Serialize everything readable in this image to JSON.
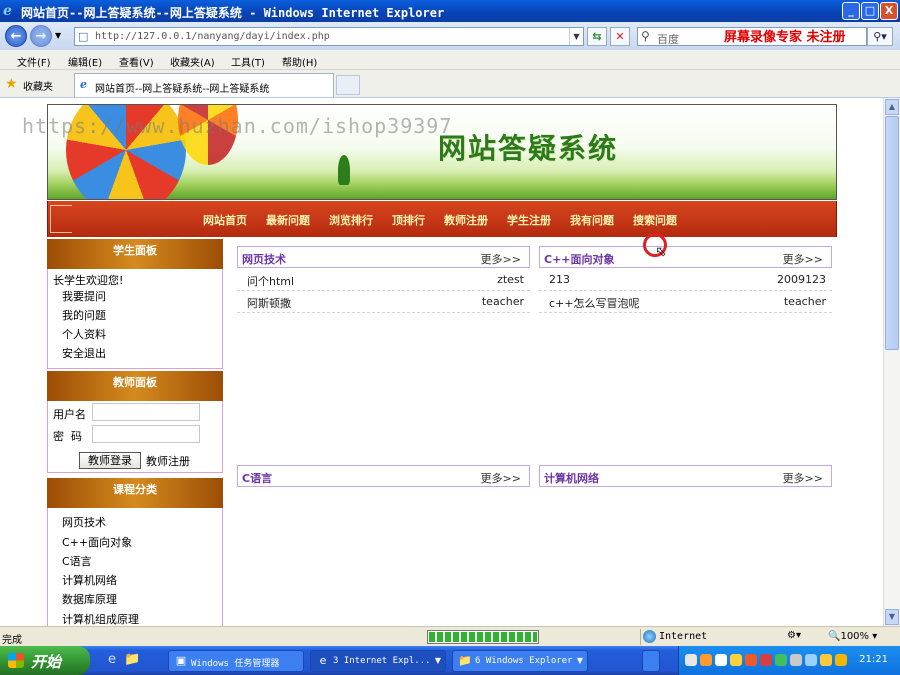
{
  "window": {
    "title": "网站首页--网上答疑系统--网上答疑系统 - Windows Internet Explorer",
    "buttons": {
      "minimize": "_",
      "maximize": "□",
      "close": "X"
    }
  },
  "addressbar": {
    "url": "http://127.0.0.1/nanyang/dayi/index.php",
    "search_placeholder": "百度",
    "watermark": "屏幕录像专家  未注册"
  },
  "menu": [
    "文件(F)",
    "编辑(E)",
    "查看(V)",
    "收藏夹(A)",
    "工具(T)",
    "帮助(H)"
  ],
  "favorites_label": "收藏夹",
  "tab": {
    "label": "网站首页--网上答疑系统--网上答疑系统"
  },
  "overlay_watermark": "https://www.huzhan.com/ishop39397",
  "site": {
    "banner_title": "网站答疑系统",
    "nav": [
      "网站首页",
      "最新问题",
      "浏览排行",
      "顶排行",
      "教师注册",
      "学生注册",
      "我有问题",
      "搜索问题"
    ],
    "student_panel": {
      "title": "学生面板",
      "welcome": "长学生欢迎您!",
      "links": [
        "我要提问",
        "我的问题",
        "个人资料",
        "安全退出"
      ]
    },
    "teacher_panel": {
      "title": "教师面板",
      "username_label": "用户名",
      "password_label": "密  码",
      "login_button": "教师登录",
      "register_link": "教师注册"
    },
    "category_panel": {
      "title": "课程分类",
      "links": [
        "网页技术",
        "C++面向对象",
        "C语言",
        "计算机网络",
        "数据库原理",
        "计算机组成原理"
      ]
    },
    "sections": [
      {
        "title": "网页技术",
        "more": "更多>>",
        "rows": [
          {
            "q": "问个html",
            "u": "ztest"
          },
          {
            "q": "阿斯顿撒",
            "u": "teacher"
          }
        ]
      },
      {
        "title": "C++面向对象",
        "more": "更多>>",
        "rows": [
          {
            "q": "213",
            "u": "2009123"
          },
          {
            "q": "c++怎么写冒泡呢",
            "u": "teacher"
          }
        ]
      },
      {
        "title": "C语言",
        "more": "更多>>",
        "rows": []
      },
      {
        "title": "计算机网络",
        "more": "更多>>",
        "rows": []
      }
    ]
  },
  "status": {
    "text": "完成",
    "progress": 1.0,
    "zone": "Internet",
    "zoom": "100%"
  },
  "taskbar": {
    "start": "开始",
    "tasks": [
      "Windows 任务管理器",
      "3 Internet Expl...",
      "6 Windows Explorer"
    ],
    "clock": "21:21"
  }
}
